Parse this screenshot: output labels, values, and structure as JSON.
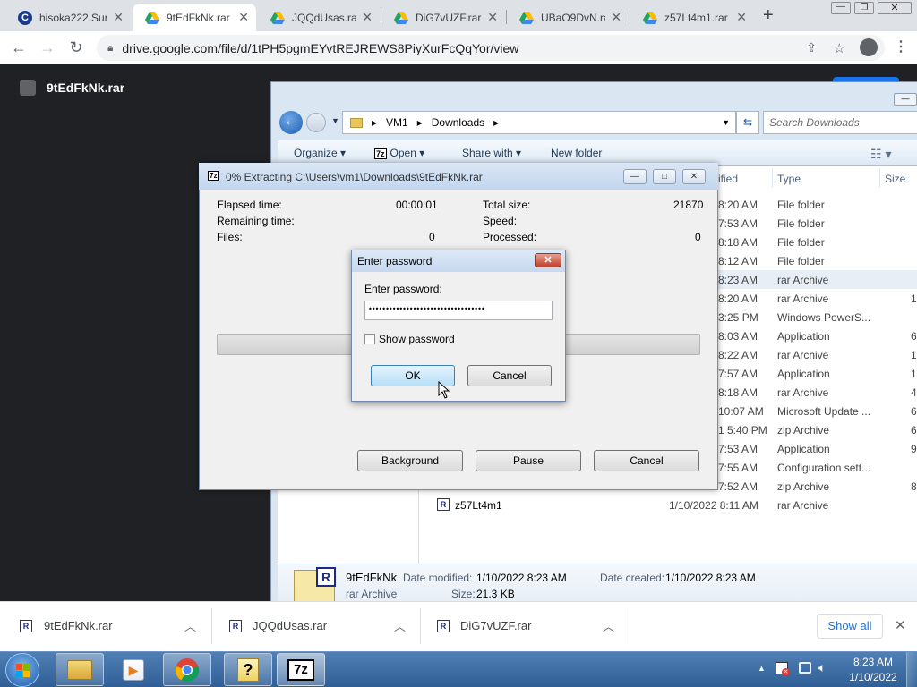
{
  "browser": {
    "tabs": [
      {
        "title": "hisoka222 Sur",
        "icon": "c-icon",
        "active": false
      },
      {
        "title": "9tEdFkNk.rar",
        "icon": "google-drive-icon",
        "active": true
      },
      {
        "title": "JQQdUsas.rar",
        "icon": "google-drive-icon",
        "active": false
      },
      {
        "title": "DiG7vUZF.rar",
        "icon": "google-drive-icon",
        "active": false
      },
      {
        "title": "UBaO9DvN.ra",
        "icon": "google-drive-icon",
        "active": false
      },
      {
        "title": "z57Lt4m1.rar",
        "icon": "google-drive-icon",
        "active": false
      }
    ],
    "url": "drive.google.com/file/d/1tPH5pgmEYvtREJREWS8PiyXurFcQqYor/view"
  },
  "viewer": {
    "file_title": "9tEdFkNk.rar"
  },
  "explorer": {
    "breadcrumb": [
      "VM1",
      "Downloads"
    ],
    "search_placeholder": "Search Downloads",
    "toolbar": {
      "organize": "Organize",
      "open": "Open",
      "share": "Share with",
      "new_folder": "New folder"
    },
    "columns": {
      "modified": "ified",
      "type": "Type",
      "size": "Size"
    },
    "rows": [
      {
        "modified": "8:20 AM",
        "type": "File folder",
        "size": ""
      },
      {
        "modified": "7:53 AM",
        "type": "File folder",
        "size": ""
      },
      {
        "modified": "8:18 AM",
        "type": "File folder",
        "size": ""
      },
      {
        "modified": "8:12 AM",
        "type": "File folder",
        "size": ""
      },
      {
        "modified": "8:23 AM",
        "type": "rar Archive",
        "size": ""
      },
      {
        "modified": "8:20 AM",
        "type": "rar Archive",
        "size": "1"
      },
      {
        "modified": "3:25 PM",
        "type": "Windows PowerS...",
        "size": ""
      },
      {
        "modified": "8:03 AM",
        "type": "Application",
        "size": "6,4"
      },
      {
        "modified": "8:22 AM",
        "type": "rar Archive",
        "size": "1"
      },
      {
        "modified": "7:57 AM",
        "type": "Application",
        "size": "15,9"
      },
      {
        "modified": "8:18 AM",
        "type": "rar Archive",
        "size": "4"
      },
      {
        "modified": "10:07 AM",
        "type": "Microsoft Update ...",
        "size": "66,4"
      },
      {
        "modified": "1 5:40 PM",
        "type": "zip Archive",
        "size": "66,4"
      },
      {
        "modified": "7:53 AM",
        "type": "Application",
        "size": "9"
      },
      {
        "modified": "7:55 AM",
        "type": "Configuration sett...",
        "size": ""
      },
      {
        "modified": "7:52 AM",
        "type": "zip Archive",
        "size": "8"
      },
      {
        "modified": "1/10/2022 8:11 AM",
        "type": "rar Archive",
        "size": "",
        "name": "z57Lt4m1"
      }
    ],
    "details": {
      "name": "9tEdFkNk",
      "type": "rar Archive",
      "date_modified_label": "Date modified:",
      "date_modified": "1/10/2022 8:23 AM",
      "date_created_label": "Date created:",
      "date_created": "1/10/2022 8:23 AM",
      "size_label": "Size:",
      "size": "21.3 KB"
    }
  },
  "zip_progress": {
    "title": "0% Extracting C:\\Users\\vm1\\Downloads\\9tEdFkNk.rar",
    "elapsed_label": "Elapsed time:",
    "elapsed": "00:00:01",
    "remaining_label": "Remaining time:",
    "files_label": "Files:",
    "files": "0",
    "total_size_label": "Total size:",
    "total_size": "21870",
    "speed_label": "Speed:",
    "processed_label": "Processed:",
    "processed": "0",
    "progress": 0,
    "background_btn": "Background",
    "pause_btn": "Pause",
    "cancel_btn": "Cancel"
  },
  "password_dialog": {
    "title": "Enter password",
    "prompt": "Enter password:",
    "value": "••••••••••••••••••••••••••••••••••",
    "show_password": "Show password",
    "ok": "OK",
    "cancel": "Cancel"
  },
  "downloads": {
    "items": [
      "9tEdFkNk.rar",
      "JQQdUsas.rar",
      "DiG7vUZF.rar"
    ],
    "show_all": "Show all"
  },
  "taskbar": {
    "time": "8:23 AM",
    "date": "1/10/2022",
    "apps": [
      "windows-explorer-icon",
      "media-player-icon",
      "chrome-icon",
      "help-icon",
      "7zip-icon"
    ]
  }
}
